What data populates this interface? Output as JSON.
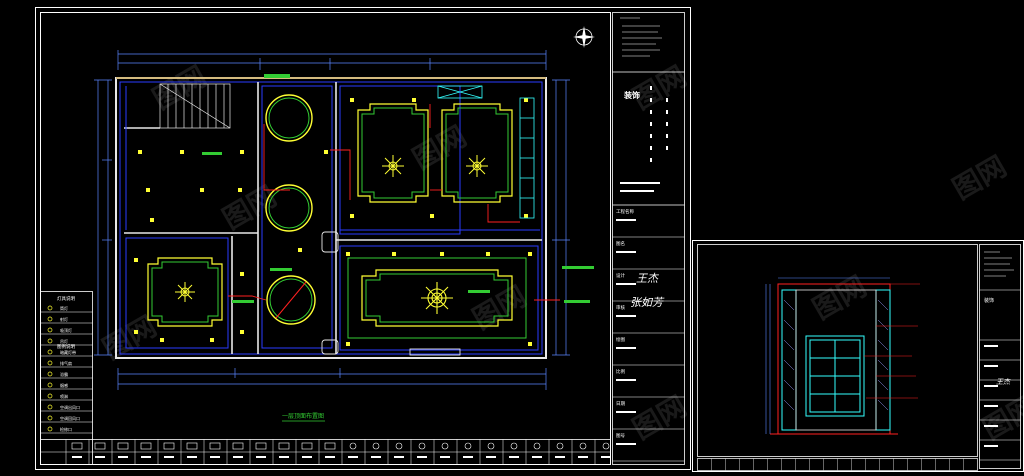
{
  "sheet_main": {
    "plan_caption": "一层顶面布置图",
    "logo_text": "装饰",
    "signature_1": "王杰",
    "signature_2": "张如芳",
    "legend": {
      "title_1": "灯具说明",
      "title_2": "图例说明",
      "rows": [
        "筒灯",
        "射灯",
        "吸顶灯",
        "吊灯",
        "暗藏灯带",
        "排气扇",
        "浴霸",
        "烟感",
        "喷淋",
        "空调出风口",
        "空调回风口",
        "检修口"
      ]
    },
    "title_block": {
      "labels": [
        "工程名称",
        "图名",
        "设计",
        "审核",
        "绘图",
        "比例",
        "日期",
        "图号"
      ]
    }
  },
  "sheet_side": {
    "logo_text": "装饰",
    "signature": "王杰"
  },
  "colors": {
    "frame": "#ffffff",
    "wall": "#e8e8e8",
    "blue": "#2a3cff",
    "green": "#33cc33",
    "yellow": "#ffff33",
    "red": "#ff2020",
    "cyan": "#33ffff",
    "dim": "#5a86ff"
  }
}
